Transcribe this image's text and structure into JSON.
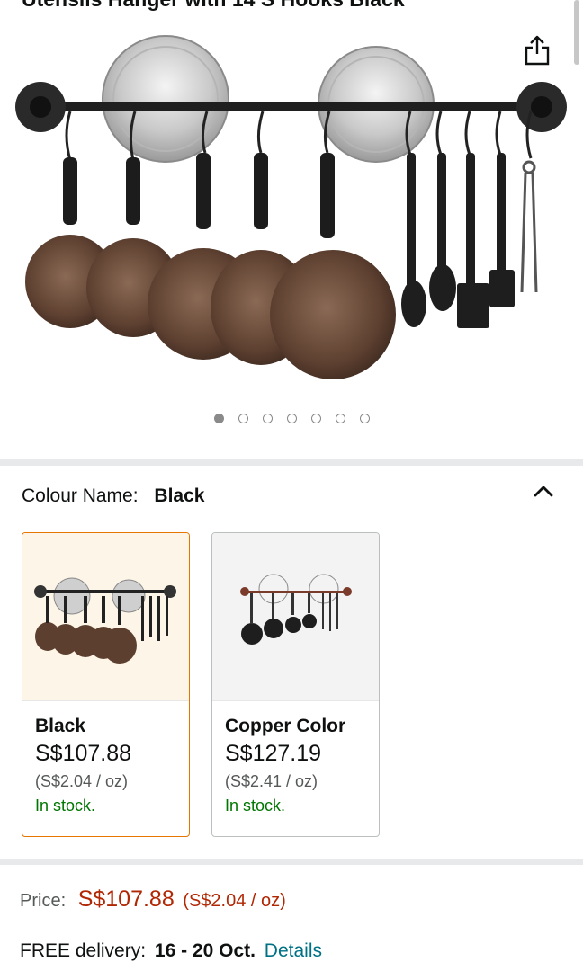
{
  "product": {
    "title": "Utensils Hanger with 14 S Hooks Black"
  },
  "gallery": {
    "image_count": 7,
    "active_index": 0
  },
  "variation": {
    "label": "Colour Name:",
    "selected": "Black",
    "options": [
      {
        "name": "Black",
        "price": "S$107.88",
        "unit_price": "(S$2.04 / oz)",
        "stock": "In stock.",
        "selected": true
      },
      {
        "name": "Copper Color",
        "price": "S$127.19",
        "unit_price": "(S$2.41 / oz)",
        "stock": "In stock.",
        "selected": false
      }
    ]
  },
  "pricing": {
    "label": "Price:",
    "value": "S$107.88",
    "unit": "(S$2.04 / oz)"
  },
  "delivery": {
    "prefix": "FREE delivery:",
    "dates": "16 - 20 Oct.",
    "link": "Details"
  },
  "colors": {
    "accent_selected": "#e77600",
    "price_red": "#b12704",
    "in_stock_green": "#007600",
    "link_teal": "#007185"
  }
}
